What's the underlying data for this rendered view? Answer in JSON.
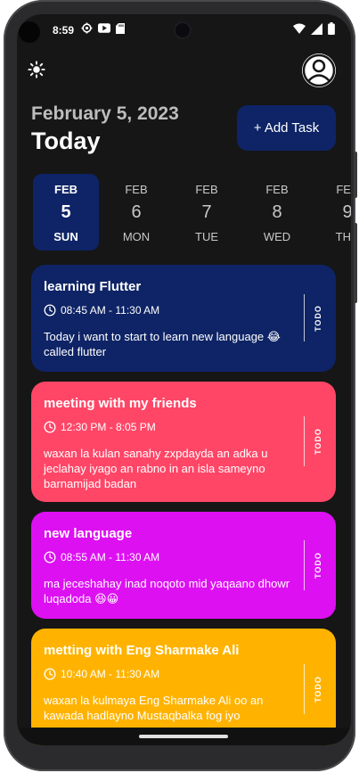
{
  "status_bar": {
    "time": "8:59",
    "left_icons": [
      "settings-gear-icon",
      "youtube-icon",
      "sd-card-icon"
    ],
    "right_icons": [
      "wifi-icon",
      "signal-icon",
      "battery-icon"
    ]
  },
  "header": {
    "theme_toggle_icon": "sun-icon",
    "avatar_icon": "profile-avatar-icon",
    "date_label": "February 5, 2023",
    "today_label": "Today",
    "add_task_label": "+ Add Task"
  },
  "date_picker": {
    "selected_index": 0,
    "days": [
      {
        "month": "FEB",
        "day": "5",
        "weekday": "SUN"
      },
      {
        "month": "FEB",
        "day": "6",
        "weekday": "MON"
      },
      {
        "month": "FEB",
        "day": "7",
        "weekday": "TUE"
      },
      {
        "month": "FEB",
        "day": "8",
        "weekday": "WED"
      },
      {
        "month": "FEB",
        "day": "9",
        "weekday": "THU"
      }
    ]
  },
  "tasks": [
    {
      "title": "learning Flutter",
      "time": "08:45 AM - 11:30 AM",
      "note": "Today i want to start to learn new language 😂 called flutter",
      "status": "TODO",
      "color": "#0e2466"
    },
    {
      "title": "meeting with my friends",
      "time": "12:30 PM - 8:05 PM",
      "note": "waxan la kulan sanahy zxpdayda an adka u jeclahay iyago an rabno in an isla sameyno barnamijad badan",
      "status": "TODO",
      "color": "#ff4667"
    },
    {
      "title": "new language",
      "time": "08:55 AM - 11:30 AM",
      "note": "ma jeceshahay inad noqoto mid yaqaano dhowr luqadoda 😆😀",
      "status": "TODO",
      "color": "#dd10f2"
    },
    {
      "title": "metting with Eng Sharmake Ali",
      "time": "10:40 AM - 11:30 AM",
      "note": "waxan la kulmaya Eng Sharmake Ali oo an kawada hadlayno Mustaqbalka fog iyo",
      "status": "TODO",
      "color": "#ffb300"
    }
  ]
}
